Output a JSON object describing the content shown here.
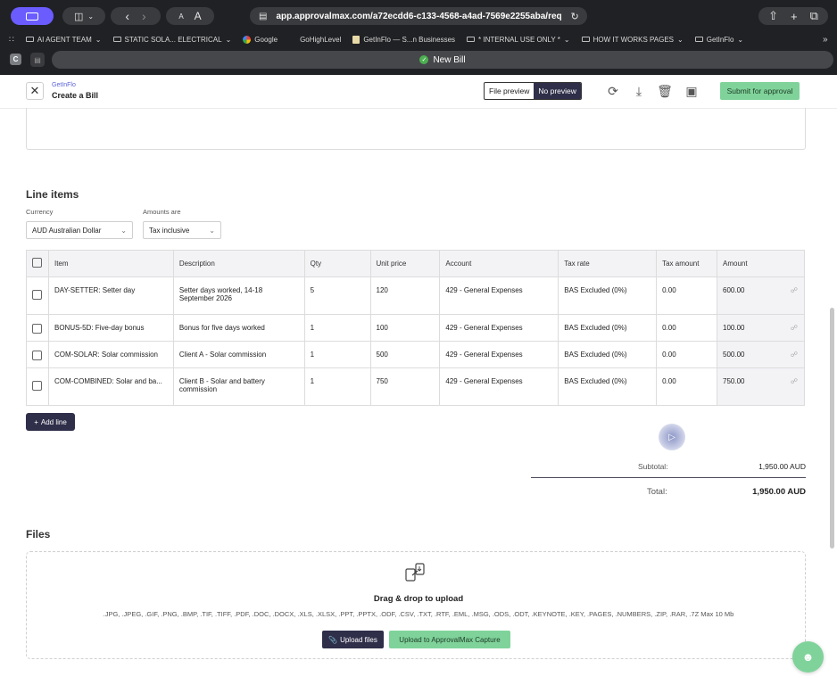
{
  "browser": {
    "url": "app.approvalmax.com/a72ecdd6-c133-4568-a4ad-7569e2255aba/req",
    "reader_small": "A",
    "reader_large": "A",
    "bookmarks": [
      {
        "label": "AI AGENT TEAM",
        "icon": "folder-icon",
        "has_menu": true
      },
      {
        "label": "STATIC SOLA... ELECTRICAL",
        "icon": "folder-icon",
        "has_menu": true
      },
      {
        "label": "Google",
        "icon": "google-icon",
        "has_menu": false
      },
      {
        "label": "GoHighLevel",
        "icon": "none",
        "has_menu": false
      },
      {
        "label": "GetInFlo — S...n Businesses",
        "icon": "page-icon",
        "has_menu": false
      },
      {
        "label": "* INTERNAL USE ONLY *",
        "icon": "folder-icon",
        "has_menu": true
      },
      {
        "label": "HOW IT WORKS PAGES",
        "icon": "folder-icon",
        "has_menu": true
      },
      {
        "label": "GetInFlo",
        "icon": "folder-icon",
        "has_menu": true
      }
    ],
    "tab_group_badge": "C",
    "active_tab": "New Bill"
  },
  "header": {
    "company": "GetInFlo",
    "title": "Create a Bill",
    "file_preview_label": "File preview",
    "no_preview_label": "No preview",
    "submit_label": "Submit for approval"
  },
  "line_items": {
    "title": "Line items",
    "currency_label": "Currency",
    "currency_value": "AUD Australian Dollar",
    "amounts_label": "Amounts are",
    "amounts_value": "Tax inclusive",
    "columns": [
      "Item",
      "Description",
      "Qty",
      "Unit price",
      "Account",
      "Tax rate",
      "Tax amount",
      "Amount"
    ],
    "rows": [
      {
        "item": "DAY-SETTER: Setter day",
        "description": "Setter days worked, 14-18 September 2026",
        "qty": "5",
        "unit_price": "120",
        "account": "429 - General Expenses",
        "tax_rate": "BAS Excluded (0%)",
        "tax_amount": "0.00",
        "amount": "600.00"
      },
      {
        "item": "BONUS-5D: Five-day bonus",
        "description": "Bonus for five days worked",
        "qty": "1",
        "unit_price": "100",
        "account": "429 - General Expenses",
        "tax_rate": "BAS Excluded (0%)",
        "tax_amount": "0.00",
        "amount": "100.00"
      },
      {
        "item": "COM-SOLAR: Solar commission",
        "description": "Client A - Solar commission",
        "qty": "1",
        "unit_price": "500",
        "account": "429 - General Expenses",
        "tax_rate": "BAS Excluded (0%)",
        "tax_amount": "0.00",
        "amount": "500.00"
      },
      {
        "item": "COM-COMBINED: Solar and ba...",
        "description": "Client B - Solar and battery commission",
        "qty": "1",
        "unit_price": "750",
        "account": "429 - General Expenses",
        "tax_rate": "BAS Excluded (0%)",
        "tax_amount": "0.00",
        "amount": "750.00"
      }
    ],
    "add_line_label": "Add line"
  },
  "totals": {
    "subtotal_label": "Subtotal:",
    "subtotal_value": "1,950.00 AUD",
    "total_label": "Total:",
    "total_value": "1,950.00 AUD"
  },
  "files": {
    "title": "Files",
    "drop_title": "Drag & drop to upload",
    "formats": ".JPG, .JPEG, .GIF, .PNG, .BMP, .TIF, .TIFF, .PDF, .DOC, .DOCX, .XLS, .XLSX, .PPT, .PPTX, .ODF, .CSV, .TXT, .RTF, .EML, .MSG, .ODS, .ODT, .KEYNOTE, .KEY, .PAGES, .NUMBERS, .ZIP, .RAR, .7Z Max 10 Mb",
    "upload_label": "Upload files",
    "capture_label": "Upload to ApprovalMax Capture"
  },
  "colors": {
    "accent_dark": "#2f2f4a",
    "accent_green": "#7fd39a",
    "link_blue": "#5b63d3"
  }
}
